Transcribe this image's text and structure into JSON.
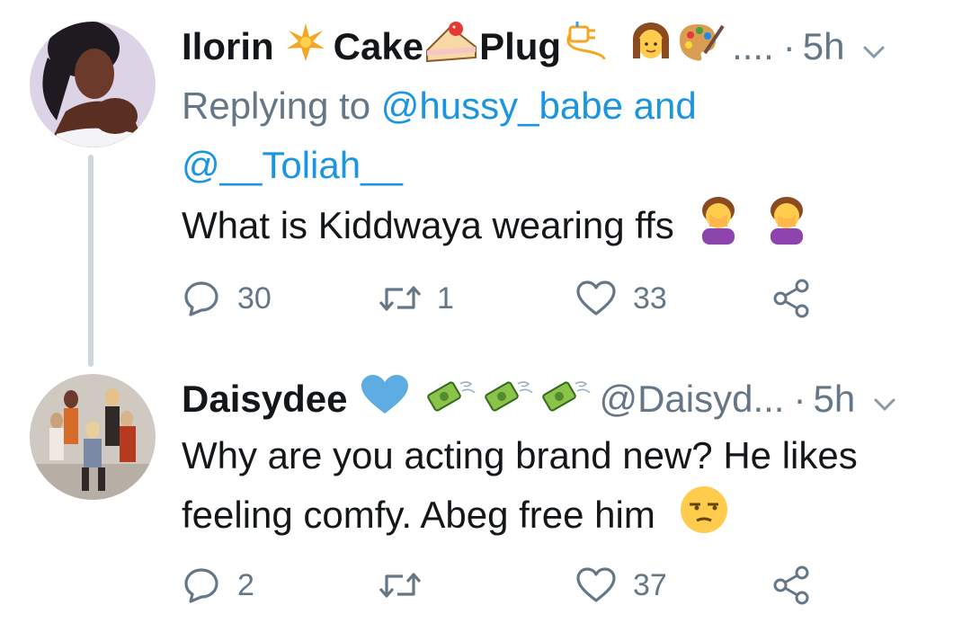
{
  "tweets": [
    {
      "display_name": "Ilorin",
      "name_word_2": "Cake",
      "name_word_3": "Plug",
      "name_ellipsis": "....",
      "separator": "·",
      "time": "5h",
      "reply_prefix": "Replying to",
      "reply_mention_1": "@hussy_babe",
      "reply_and": "and",
      "reply_mention_2": "@__Toliah__",
      "text": "What is Kiddwaya wearing ffs",
      "replies": "30",
      "retweets": "1",
      "likes": "33",
      "icons": [
        "sparkle-icon",
        "cake-icon",
        "plug-icon",
        "woman-emoji-icon",
        "palette-icon",
        "facepalm-emoji-icon"
      ]
    },
    {
      "display_name": "Daisydee",
      "handle": "@Daisyd...",
      "separator": "·",
      "time": "5h",
      "text_line_1": "Why are you acting brand new? He likes",
      "text_line_2": "feeling comfy. Abeg free him",
      "replies": "2",
      "retweets": "",
      "likes": "37",
      "icons": [
        "blue-heart-icon",
        "flying-money-icon",
        "unamused-face-icon"
      ]
    }
  ],
  "colors": {
    "text": "#14171a",
    "muted": "#657786",
    "link": "#1b95e0",
    "thread_line": "#ccd6dd",
    "heart_blue": "#5dade2"
  }
}
